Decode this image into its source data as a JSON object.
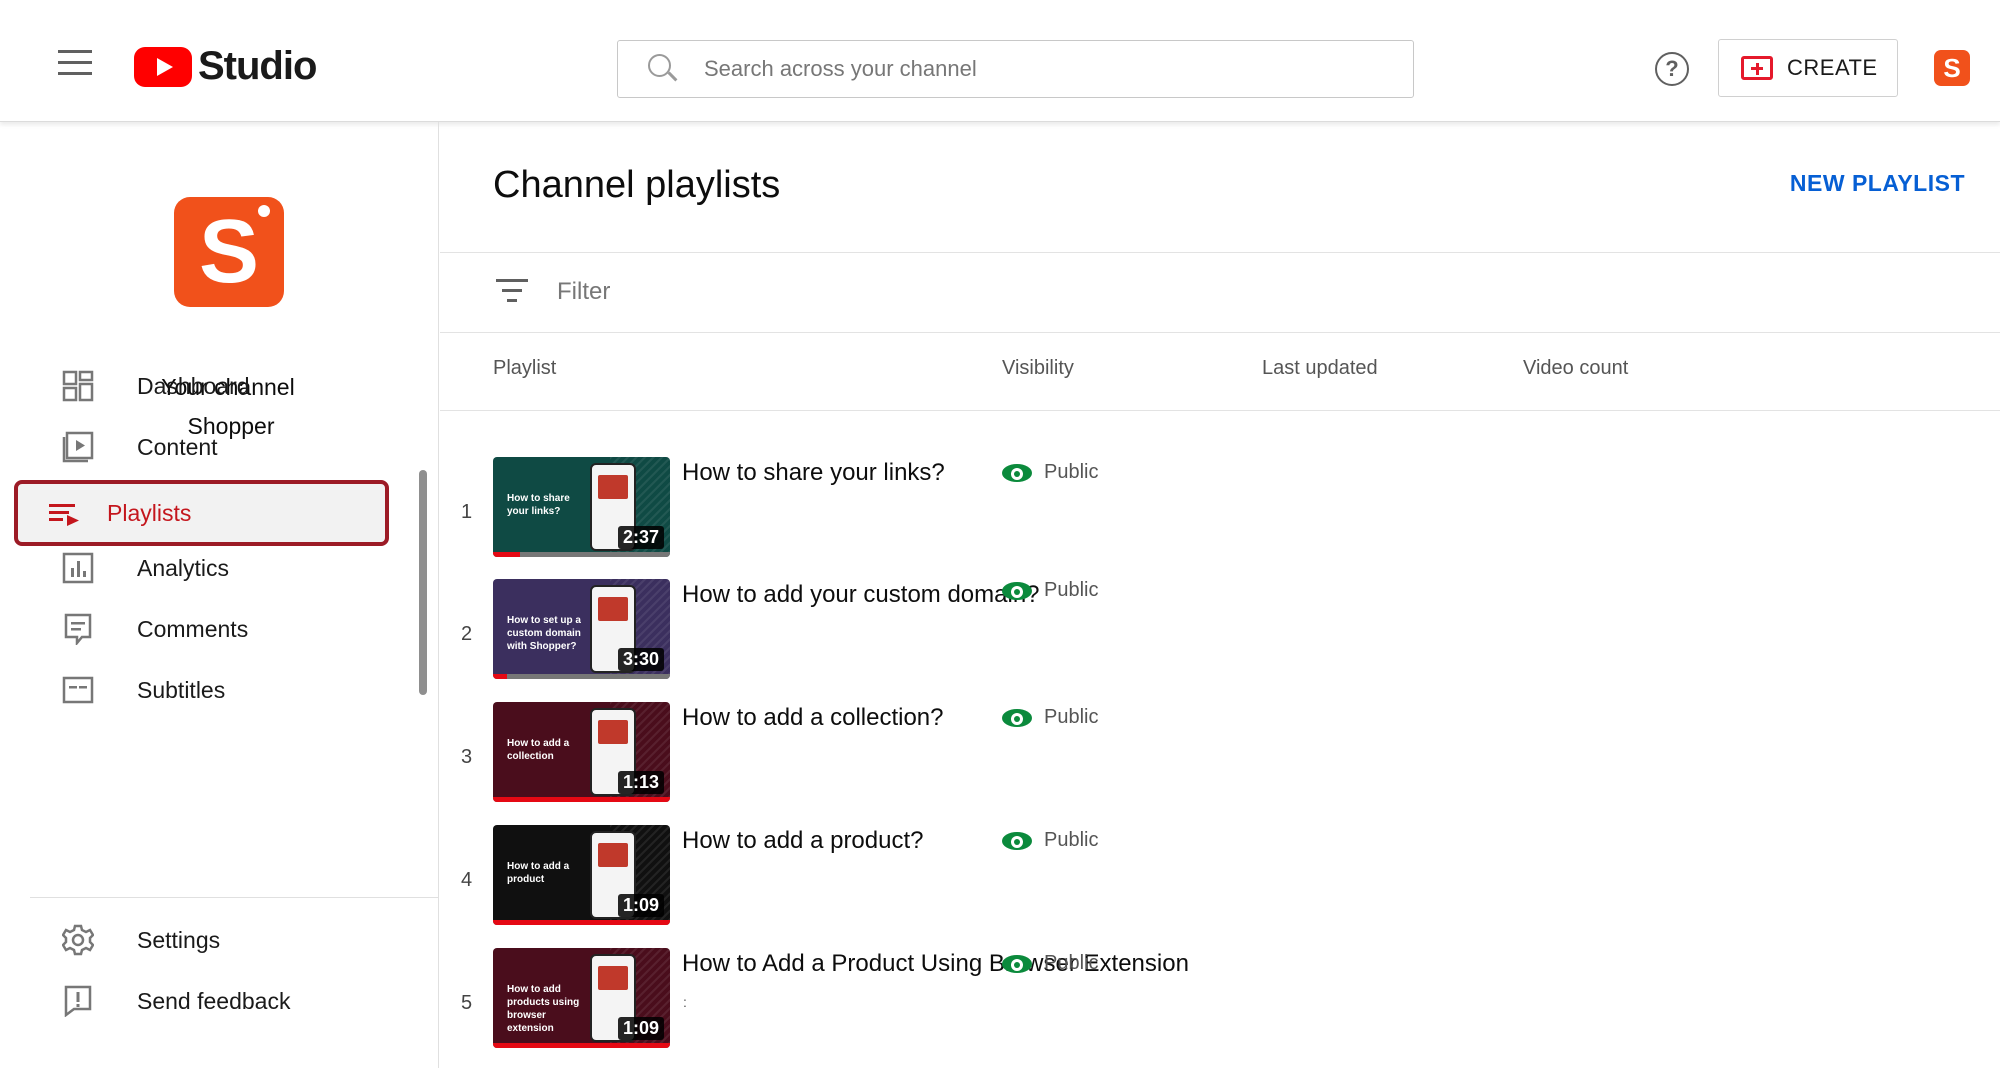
{
  "header": {
    "logo_text": "Studio",
    "search_placeholder": "Search across your channel",
    "create_label": "CREATE",
    "help_glyph": "?",
    "avatar_letter": "S"
  },
  "sidebar": {
    "avatar_letter": "S",
    "channel_title": "Your channel",
    "channel_name": "Shopper",
    "items": [
      {
        "label": "Dashboard",
        "icon": "dashboard-icon",
        "active": false
      },
      {
        "label": "Content",
        "icon": "content-icon",
        "active": false
      },
      {
        "label": "Playlists",
        "icon": "playlists-icon",
        "active": true
      },
      {
        "label": "Analytics",
        "icon": "analytics-icon",
        "active": false
      },
      {
        "label": "Comments",
        "icon": "comments-icon",
        "active": false
      },
      {
        "label": "Subtitles",
        "icon": "subtitles-icon",
        "active": false
      }
    ],
    "bottom_items": [
      {
        "label": "Settings",
        "icon": "gear-icon"
      },
      {
        "label": "Send feedback",
        "icon": "feedback-icon"
      }
    ]
  },
  "main": {
    "title": "Channel playlists",
    "new_playlist_label": "NEW PLAYLIST",
    "filter_label": "Filter",
    "columns": [
      "Playlist",
      "Visibility",
      "Last updated",
      "Video count"
    ],
    "rows": [
      {
        "num": "1",
        "title": "How to share your links?",
        "thumb_text": "How to share your links?",
        "duration": "2:37",
        "visibility": "Public",
        "thumb_color": "#0f4a44",
        "progress": 0.15
      },
      {
        "num": "2",
        "title": "How to add your custom domain?",
        "thumb_text": "How to set up a custom domain with Shopper?",
        "duration": "3:30",
        "visibility": "Public",
        "thumb_color": "#3b2f5e",
        "progress": 0.08
      },
      {
        "num": "3",
        "title": "How to add a collection?",
        "thumb_text": "How to add a collection",
        "duration": "1:13",
        "visibility": "Public",
        "thumb_color": "#4a0d1c",
        "progress": 1.0
      },
      {
        "num": "4",
        "title": "How to add a product?",
        "thumb_text": "How to add a product",
        "duration": "1:09",
        "visibility": "Public",
        "thumb_color": "#101010",
        "progress": 1.0
      },
      {
        "num": "5",
        "title": "How to Add a Product Using Browser Extension",
        "thumb_text": "How to add products using browser extension",
        "duration": "1:09",
        "visibility": "Public",
        "thumb_color": "#4a0d1c",
        "progress": 1.0,
        "sub_mark": ":"
      }
    ]
  },
  "colors": {
    "brand_red": "#ff0000",
    "active_text": "#c4161d",
    "active_border": "#9c1b26",
    "link_blue": "#065fd4",
    "public_green": "#0b8a3c",
    "avatar_orange": "#f1511b"
  }
}
